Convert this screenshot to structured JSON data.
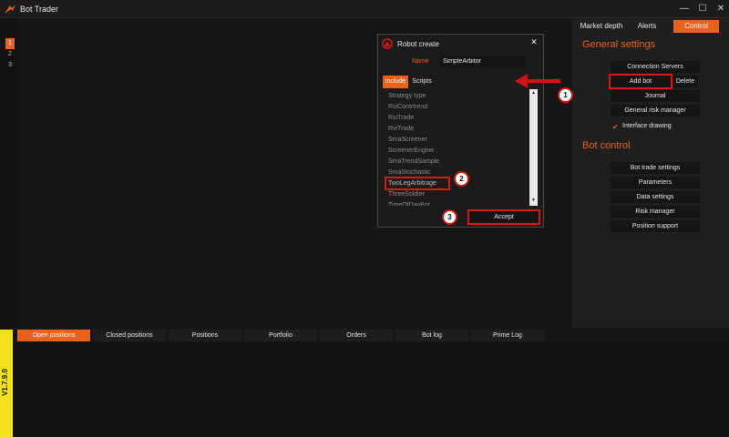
{
  "app": {
    "title": "Bot Trader"
  },
  "window_controls": {
    "minimize": "—",
    "maximize": "☐",
    "close": "✕"
  },
  "left_tabs": [
    "1",
    "2",
    "3"
  ],
  "right_panel": {
    "tabs": [
      "Market depth",
      "Alerts",
      "Control"
    ],
    "active_tab": "Control",
    "general_settings_title": "General settings",
    "connection_servers": "Connection Servers",
    "add_bot": "Add bot",
    "delete": "Delete",
    "journal": "Journal",
    "general_risk_manager": "General risk manager",
    "interface_drawing": "Interface drawing",
    "interface_drawing_checked": true,
    "bot_control_title": "Bot control",
    "bot_trade_settings": "Bot trade settings",
    "parameters": "Parameters",
    "data_settings": "Data settings",
    "risk_manager": "Risk manager",
    "position_support": "Position support"
  },
  "dialog": {
    "title": "Robot create",
    "close": "✕",
    "name_label": "Name",
    "name_value": "SimpleArbitor",
    "tabs": [
      "Include",
      "Scripts"
    ],
    "active_tab": "Include",
    "list_items": [
      "Strategy type",
      "RsiContrtrend",
      "RsiTrade",
      "RviTrade",
      "SmaScreener",
      "ScreenerEngine",
      "SmaTrendSample",
      "SmaStochastic",
      "TwoLegArbitrage",
      "ThreeSoldier",
      "TimeOfDayBot"
    ],
    "selected_item": "TwoLegArbitrage",
    "accept": "Accept",
    "scroll_up": "▲",
    "scroll_down": "▼"
  },
  "callouts": [
    "1",
    "2",
    "3"
  ],
  "bottom_tabs": [
    "Open positions",
    "Closed positions",
    "Positions",
    "Portfolio",
    "Orders",
    "Bot log",
    "Prime Log"
  ],
  "active_bottom_tab": "Open positions",
  "version": "V1.7.9.0",
  "colors": {
    "accent": "#e8621e",
    "highlight": "#d91818",
    "version_bg": "#f1e11f"
  }
}
